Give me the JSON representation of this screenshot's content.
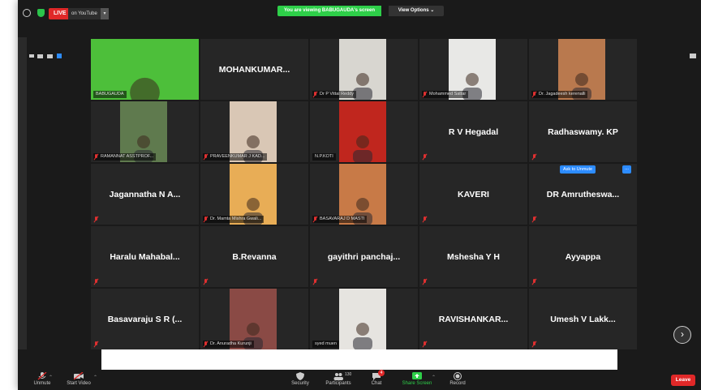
{
  "topbar": {
    "live_label": "LIVE",
    "youtube_label": "on YouTube",
    "youtube_caret": "▾",
    "viewing_text": "You are viewing BABUGAUDA's screen",
    "view_options": "View Options ⌄"
  },
  "tiles": [
    {
      "label": "BABUGAUDA",
      "muted": false,
      "kind": "video",
      "active": true,
      "bg": "#4dbf3a"
    },
    {
      "name": "MOHANKUMAR...",
      "muted": false,
      "kind": "name"
    },
    {
      "label": "Dr P Vittal Reddy",
      "muted": true,
      "kind": "video",
      "bg": "#d8d6d0"
    },
    {
      "label": "Mohammed Sattar",
      "muted": true,
      "kind": "video",
      "bg": "#e8e8e6"
    },
    {
      "label": "Dr. Jagadeesh kerenalli",
      "muted": true,
      "kind": "video",
      "bg": "#b9794e"
    },
    {
      "label": "RAMANNAT ASSTPROF...",
      "muted": true,
      "kind": "video",
      "bg": "#5f7a4e"
    },
    {
      "label": "PRAVEENKUMAR J KAD...",
      "muted": true,
      "kind": "video",
      "bg": "#d9c7b5"
    },
    {
      "label": "N.P.KOTI",
      "muted": false,
      "kind": "video",
      "bg": "#c0261e"
    },
    {
      "name": "R V Hegadal",
      "muted": true,
      "kind": "name"
    },
    {
      "name": "Radhaswamy. KP",
      "muted": true,
      "kind": "name"
    },
    {
      "name": "Jagannatha N A...",
      "muted": true,
      "kind": "name"
    },
    {
      "label": "Dr. Mamta Mishra Gwali...",
      "muted": true,
      "kind": "video",
      "bg": "#e8ad56"
    },
    {
      "label": "BASAVARAJ D MASTI",
      "muted": true,
      "kind": "video",
      "bg": "#c87a47"
    },
    {
      "name": "KAVERI",
      "muted": true,
      "kind": "name"
    },
    {
      "name": "DR Amrutheswa...",
      "muted": true,
      "kind": "name"
    },
    {
      "name": "Haralu Mahabal...",
      "muted": true,
      "kind": "name"
    },
    {
      "name": "B.Revanna",
      "muted": true,
      "kind": "name"
    },
    {
      "name": "gayithri panchaj...",
      "muted": true,
      "kind": "name"
    },
    {
      "name": "Mshesha Y H",
      "muted": true,
      "kind": "name"
    },
    {
      "name": "Ayyappa",
      "muted": true,
      "kind": "name"
    },
    {
      "name": "Basavaraju S R (...",
      "muted": true,
      "kind": "name"
    },
    {
      "label": "Dr. Anuradha Kurunji",
      "muted": true,
      "kind": "video",
      "bg": "#8a4a45"
    },
    {
      "label": "syed muen",
      "muted": false,
      "kind": "video",
      "bg": "#e6e4e0"
    },
    {
      "name": "RAVISHANKAR...",
      "muted": true,
      "kind": "name"
    },
    {
      "name": "Umesh V Lakk...",
      "muted": true,
      "kind": "name"
    }
  ],
  "ask_to_unmute": "Ask to Unmute",
  "ask_more": "...",
  "next_page": "›",
  "footer": {
    "unmute": "Unmute",
    "start_video": "Start Video",
    "security": "Security",
    "participants": "Participants",
    "participants_count": "130",
    "chat": "Chat",
    "chat_badge": "4",
    "share_screen": "Share Screen",
    "record": "Record",
    "leave": "Leave"
  },
  "colors": {
    "accent_green": "#2ecf49",
    "accent_blue": "#2d8cff",
    "danger_red": "#e02828",
    "tile_bg": "#262626"
  }
}
